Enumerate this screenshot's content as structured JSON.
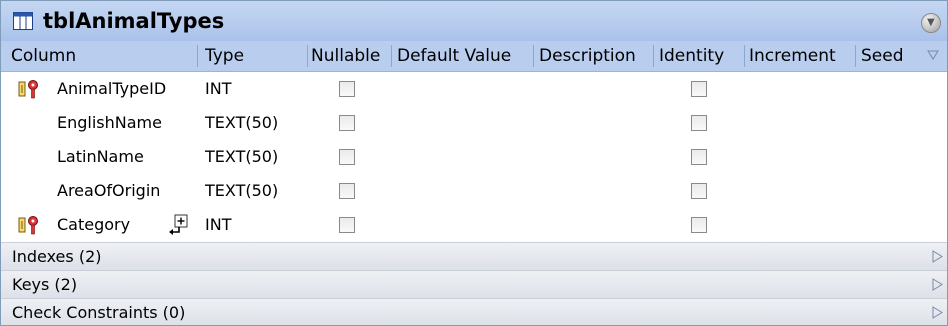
{
  "table": {
    "name": "tblAnimalTypes",
    "icon": "table-grid-icon"
  },
  "columns_header": [
    "Column",
    "Type",
    "Nullable",
    "Default Value",
    "Description",
    "Identity",
    "Increment",
    "Seed"
  ],
  "rows": [
    {
      "name": "AnimalTypeID",
      "type": "INT",
      "primary_key": true,
      "foreign_key": false,
      "nullable": false,
      "identity": false
    },
    {
      "name": "EnglishName",
      "type": "TEXT(50)",
      "primary_key": false,
      "foreign_key": false,
      "nullable": false,
      "identity": false
    },
    {
      "name": "LatinName",
      "type": "TEXT(50)",
      "primary_key": false,
      "foreign_key": false,
      "nullable": false,
      "identity": false
    },
    {
      "name": "AreaOfOrigin",
      "type": "TEXT(50)",
      "primary_key": false,
      "foreign_key": false,
      "nullable": false,
      "identity": false
    },
    {
      "name": "Category",
      "type": "INT",
      "primary_key": true,
      "foreign_key": true,
      "nullable": false,
      "identity": false
    }
  ],
  "sections": [
    {
      "label": "Indexes (2)"
    },
    {
      "label": "Keys (2)"
    },
    {
      "label": "Check Constraints (0)"
    }
  ],
  "colors": {
    "title_bar": "#b7ccee",
    "header_bar": "#b9cdee",
    "section_bar": "#e4e7ed"
  }
}
